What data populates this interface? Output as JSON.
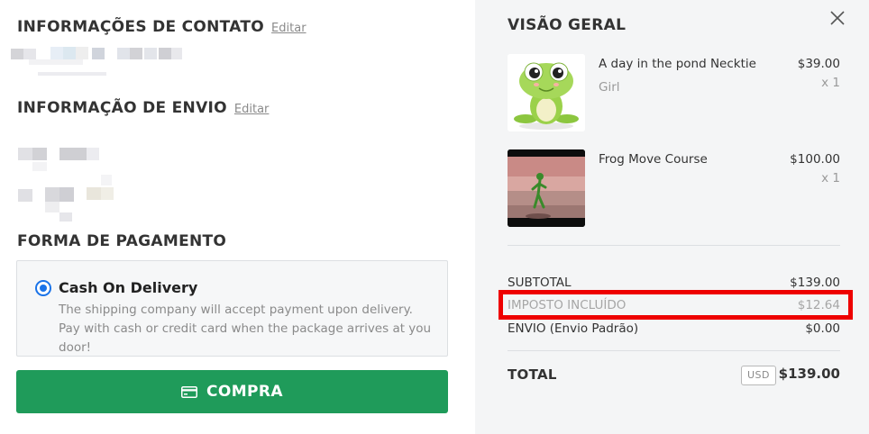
{
  "contact": {
    "title": "INFORMAÇÕES DE CONTATO",
    "edit_label": "Editar"
  },
  "shipping_info": {
    "title": "INFORMAÇÃO DE ENVIO",
    "edit_label": "Editar"
  },
  "payment": {
    "title": "FORMA DE PAGAMENTO",
    "method_name": "Cash On Delivery",
    "method_selected": true,
    "description": "The shipping company will accept payment upon delivery. Pay with cash or credit card when the package arrives at you door!"
  },
  "buy_button": {
    "label": "COMPRA",
    "icon": "credit-card-icon"
  },
  "overview": {
    "title": "VISÃO GERAL",
    "close_icon": "close-icon",
    "items": [
      {
        "name": "A day in the pond Necktie",
        "variant": "Girl",
        "price": "$39.00",
        "qty": "x 1"
      },
      {
        "name": "Frog Move Course",
        "variant": "",
        "price": "$100.00",
        "qty": "x 1"
      }
    ],
    "summary": {
      "subtotal_label": "SUBTOTAL",
      "subtotal_value": "$139.00",
      "tax_label": "IMPOSTO INCLUÍDO",
      "tax_value": "$12.64",
      "shipping_label": "ENVIO  (Envio Padrão)",
      "shipping_value": "$0.00",
      "total_label": "TOTAL",
      "currency": "USD",
      "total_value": "$139.00"
    }
  },
  "colors": {
    "accent_green": "#1f9b5a",
    "radio_blue": "#1a73e8",
    "highlight_red": "#ee0000"
  }
}
